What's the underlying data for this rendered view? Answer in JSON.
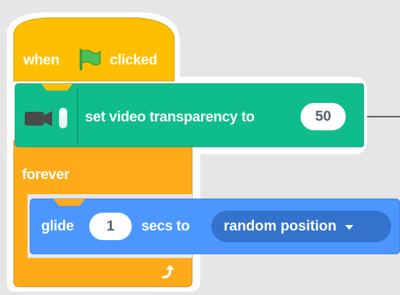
{
  "colors": {
    "background": "#e6e6e6",
    "events_block": "#ffbf00",
    "control_block": "#ffab19",
    "video_block": "#0fbd8c",
    "motion_block": "#4c97ff",
    "dropdown_fill": "#3373cc"
  },
  "hat_block": {
    "text_before": "when",
    "icon": "green-flag-icon",
    "text_after": "clicked"
  },
  "video_block": {
    "icon": "video-sensing-icon",
    "label": "set video transparency to",
    "value": "50"
  },
  "forever_block": {
    "label": "forever",
    "icon": "loop-arrow-icon"
  },
  "glide_block": {
    "label_start": "glide",
    "value": "1",
    "label_mid": "secs to",
    "dropdown": "random position"
  }
}
